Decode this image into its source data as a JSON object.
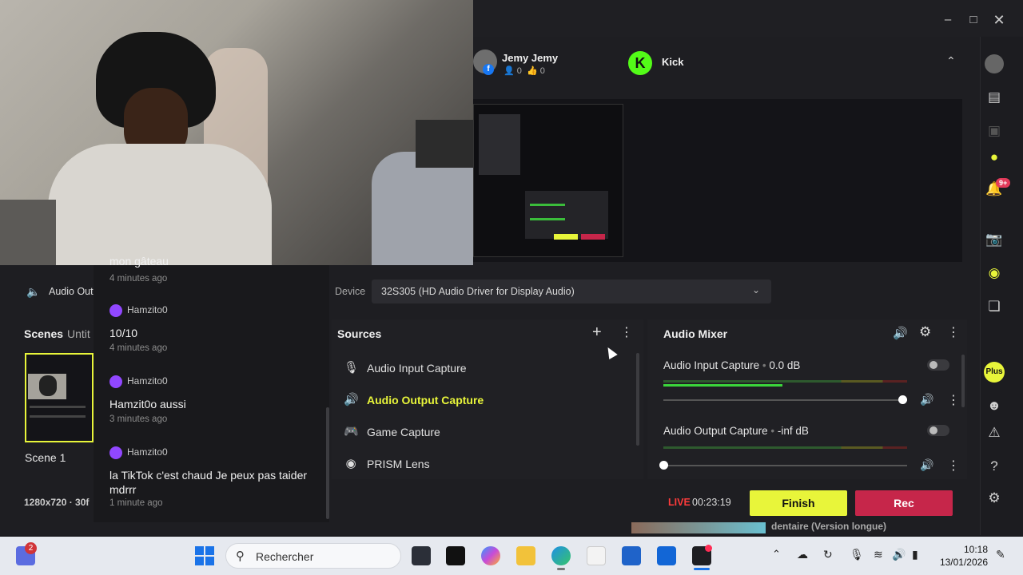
{
  "channels": [
    {
      "name": "Jemy Jemy",
      "viewers": "0",
      "likes": "0",
      "platform": "facebook"
    },
    {
      "name": "Kick",
      "platform": "kick"
    }
  ],
  "device": {
    "label": "Device",
    "value": "32S305 (HD Audio Driver for Display Audio)"
  },
  "audio_output_tab": "Audio Out",
  "scenes": {
    "title": "Scenes",
    "collection": "Untit",
    "items": [
      {
        "label": "Scene 1"
      }
    ]
  },
  "resolution": "1280x720 · 30f",
  "chat": {
    "partial_top": "mon gâteau",
    "partial_top_time": "4 minutes ago",
    "messages": [
      {
        "user": "Hamzito0",
        "text": "10/10",
        "time": "4 minutes ago"
      },
      {
        "user": "Hamzito0",
        "text": "Hamzit0o aussi",
        "time": "3 minutes ago"
      },
      {
        "user": "Hamzito0",
        "text": "la TikTok c'est chaud Je peux pas taider mdrrr",
        "time": "1 minute ago"
      }
    ]
  },
  "sources": {
    "title": "Sources",
    "items": [
      {
        "label": "Audio Input Capture",
        "icon": "microphone-icon",
        "active": false
      },
      {
        "label": "Audio Output Capture",
        "icon": "speaker-icon",
        "active": true
      },
      {
        "label": "Game Capture",
        "icon": "gamepad-icon",
        "active": false
      },
      {
        "label": "PRISM Lens",
        "icon": "lens-icon",
        "active": false
      }
    ]
  },
  "mixer": {
    "title": "Audio Mixer",
    "channels": [
      {
        "name": "Audio Input Capture",
        "level": "0.0 dB",
        "meter_fill": 0.49,
        "volume": 0.98
      },
      {
        "name": "Audio Output Capture",
        "level": "-inf dB",
        "meter_fill": 0.0,
        "volume": 0.0
      }
    ]
  },
  "status": {
    "live_label": "LIVE",
    "timer": "00:23:19"
  },
  "buttons": {
    "finish": "Finish",
    "rec": "Rec"
  },
  "sidebar": {
    "notif_badge": "9+",
    "plus_label": "Plus"
  },
  "taskbar": {
    "search_placeholder": "Rechercher",
    "time": "10:18",
    "date": "13/01/2026",
    "badge": "2"
  },
  "background_text": "dentaire (Version longue)",
  "colors": {
    "accent": "#e8f53a",
    "rec": "#c6264a",
    "live": "#ff3b3b",
    "twitch": "#9147ff",
    "kick": "#53fc18"
  }
}
